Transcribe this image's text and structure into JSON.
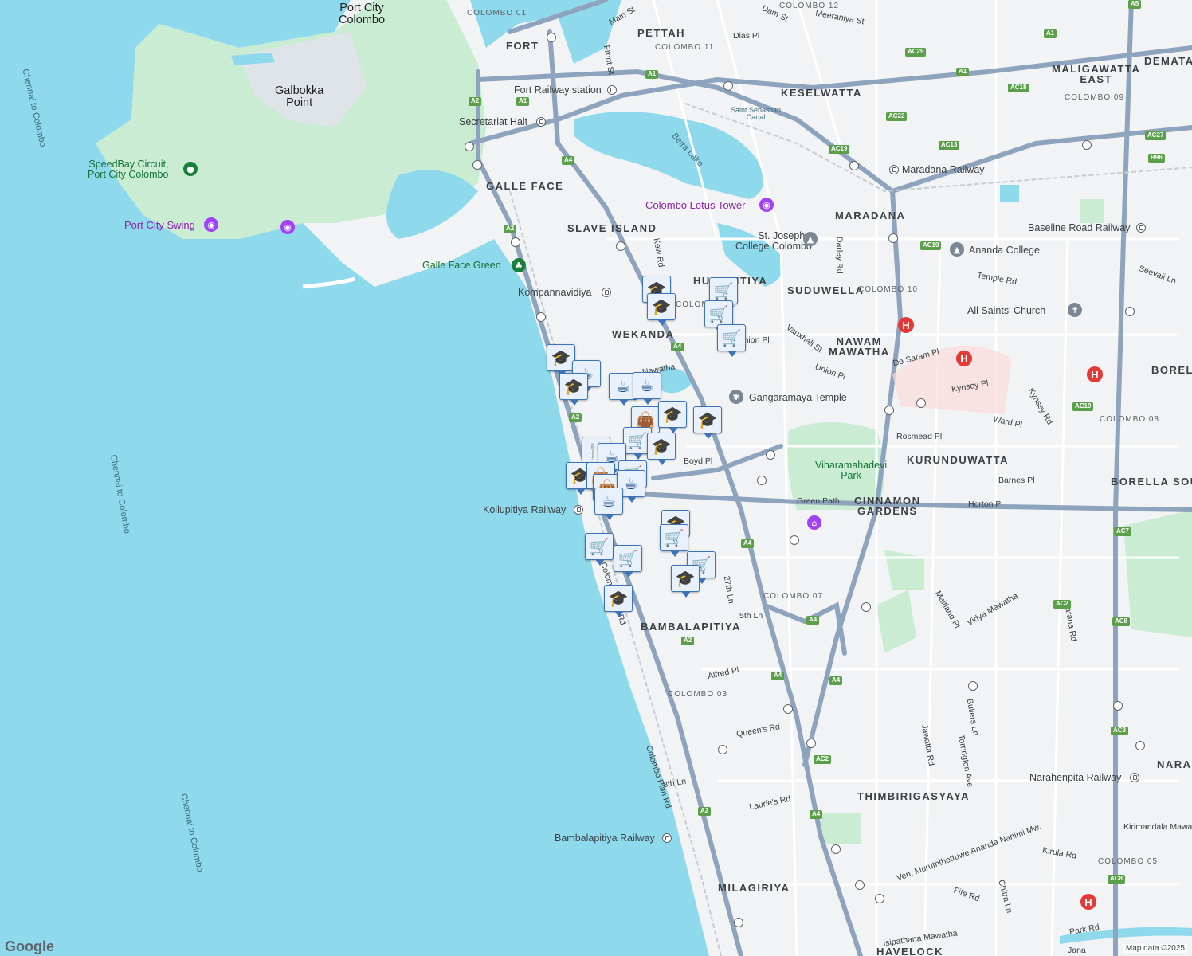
{
  "map": {
    "colors": {
      "water": "#8fd9ec",
      "land": "#f1f3f4",
      "park": "#c9ecd3",
      "major_road": "#8ea3bd",
      "minor_road": "#ffffff",
      "marker_border": "#3d73b8",
      "hospital": "#e53935",
      "poi_purple": "#8e24aa"
    },
    "places": {
      "port_city": "Port City\nColombo",
      "galbokka": "Galbokka\nPoint",
      "speedbay": "SpeedBay Circuit,\nPort City Colombo",
      "port_city_swing": "Port City Swing",
      "galle_face_green": "Galle Face Green",
      "lotus_tower": "Colombo Lotus Tower",
      "st_josephs": "St. Joseph's\nCollege Colombo",
      "ananda": "Ananda College",
      "all_saints": "All Saints' Church -",
      "gangaramaya": "Gangaramaya Temple",
      "viharamahadevi": "Viharamahadevi\nPark",
      "saint_sebastian": "Saint Sebastian\nCanal",
      "beira": "Beira Lake",
      "fort_rail": "Fort Railway station",
      "secretariat": "Secretariat Halt",
      "maradana_rail": "Maradana Railway",
      "baseline_rail": "Baseline Road Railway",
      "kompannavidiya": "Kompannavidiya",
      "kollupitiya_rail": "Kollupitiya Railway",
      "bambalapitiya_rail": "Bambalapitiya Railway",
      "narahenpita_rail": "Narahenpita Railway",
      "kirimandala": "Kirimandala Mawatha"
    },
    "areas": [
      "FORT",
      "PETTAH",
      "KESELWATTA",
      "MALIGAWATTA\nEAST",
      "DEMATA",
      "GALLE FACE",
      "SLAVE ISLAND",
      "MARADANA",
      "HUNUPITIYA",
      "SUDUWELLA",
      "WEKANDA",
      "NAWAM\nMAWATHA",
      "BORELL",
      "KURUNDUWATTA",
      "BORELLA SOUT",
      "CINNAMON\nGARDENS",
      "BAMBALAPITIYA",
      "THIMBIRIGASYAYA",
      "NARAH",
      "MILAGIRIYA",
      "HAVELOCK"
    ],
    "districts": [
      "COLOMBO 01",
      "COLOMBO 11",
      "COLOMBO 12",
      "COLOMBO 09",
      "COLOMBO 10",
      "COLOMBO 08",
      "COLOMBO 07",
      "COLOMBO 03",
      "COLOMBO 05",
      "COLOMBO 02"
    ],
    "streets": [
      "Main St",
      "Dam St",
      "Meeraniya St",
      "Dias Pl",
      "Front St",
      "Kew Rd",
      "Darley Rd",
      "Temple Rd",
      "Seevali Ln",
      "De Saram Pl",
      "Union Pl",
      "Vauxhall St",
      "Kynsey Pl",
      "Kynsey Rd",
      "Ward Pl",
      "Rosmead Pl",
      "Barnes Pl",
      "Boyd Pl",
      "Green Path",
      "Horton Pl",
      "27th Ln",
      "5th Ln",
      "Maitland Pl",
      "Vidya Mawatha",
      "Sarana Rd",
      "Alfred Pl",
      "Queen's Rd",
      "Jawatta Rd",
      "Bullers Ln",
      "Torrington Ave",
      "8th Ln",
      "Laurie's Rd",
      "Colombo Plan Rd",
      "Ven. Muruththettuwe Ananda Nahimi Mw.",
      "Kirula Rd",
      "Fife Rd",
      "Chitra Ln",
      "Park Rd",
      "Isipathana Mawatha",
      "Jana",
      "Nawatha",
      "Union Pl"
    ],
    "sea_labels": [
      "Chennai to Colombo",
      "Chennai to Colombo",
      "Chennai to Colombo"
    ],
    "route_shields": [
      "A1",
      "A2",
      "A4",
      "AC29",
      "AC18",
      "AC22",
      "AC19",
      "AC13",
      "AC27",
      "B96",
      "AC7",
      "AC2",
      "AC8",
      "A5"
    ],
    "markers": [
      "school",
      "shopping",
      "cafe",
      "restaurant",
      "bag"
    ],
    "logo": "Google",
    "attribution": "Map data ©2025"
  }
}
